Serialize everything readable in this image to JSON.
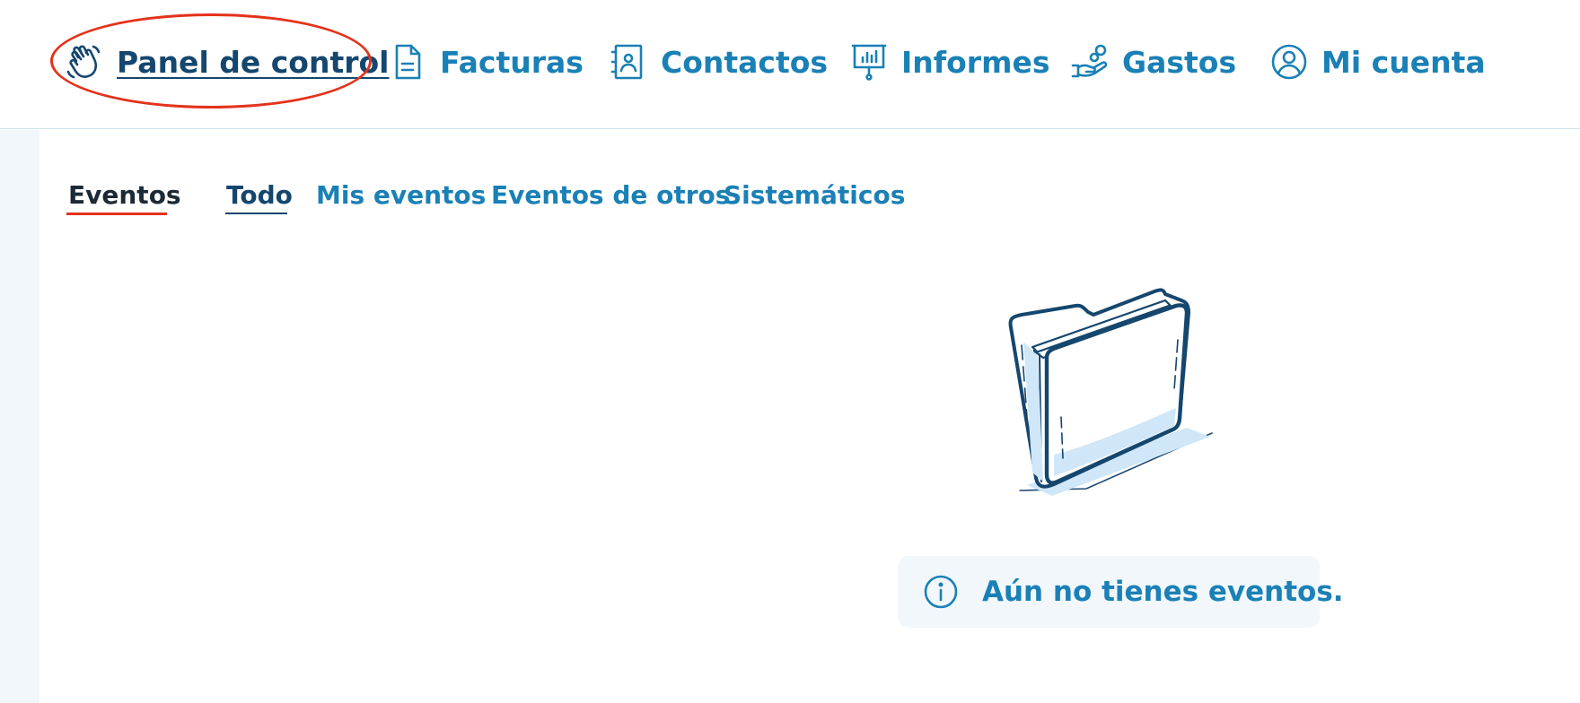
{
  "nav": {
    "items": [
      {
        "label": "Panel de control",
        "icon": "waving-hand-icon",
        "active": true
      },
      {
        "label": "Facturas",
        "icon": "document-icon",
        "active": false
      },
      {
        "label": "Contactos",
        "icon": "contact-book-icon",
        "active": false
      },
      {
        "label": "Informes",
        "icon": "presentation-board-icon",
        "active": false
      },
      {
        "label": "Gastos",
        "icon": "hand-coins-icon",
        "active": false
      },
      {
        "label": "Mi cuenta",
        "icon": "user-circle-icon",
        "active": false
      }
    ]
  },
  "events": {
    "title": "Eventos",
    "tabs": [
      {
        "label": "Todo",
        "active": true
      },
      {
        "label": "Mis eventos",
        "active": false
      },
      {
        "label": "Eventos de otros",
        "active": false
      },
      {
        "label": "Sistemáticos",
        "active": false
      }
    ],
    "empty_icon": "empty-folder-icon",
    "empty_message": "Aún no tienes eventos."
  },
  "colors": {
    "link": "#1a80b6",
    "active": "#15466e",
    "highlight": "#e4321b",
    "panel_bg": "#f1f7fb"
  }
}
